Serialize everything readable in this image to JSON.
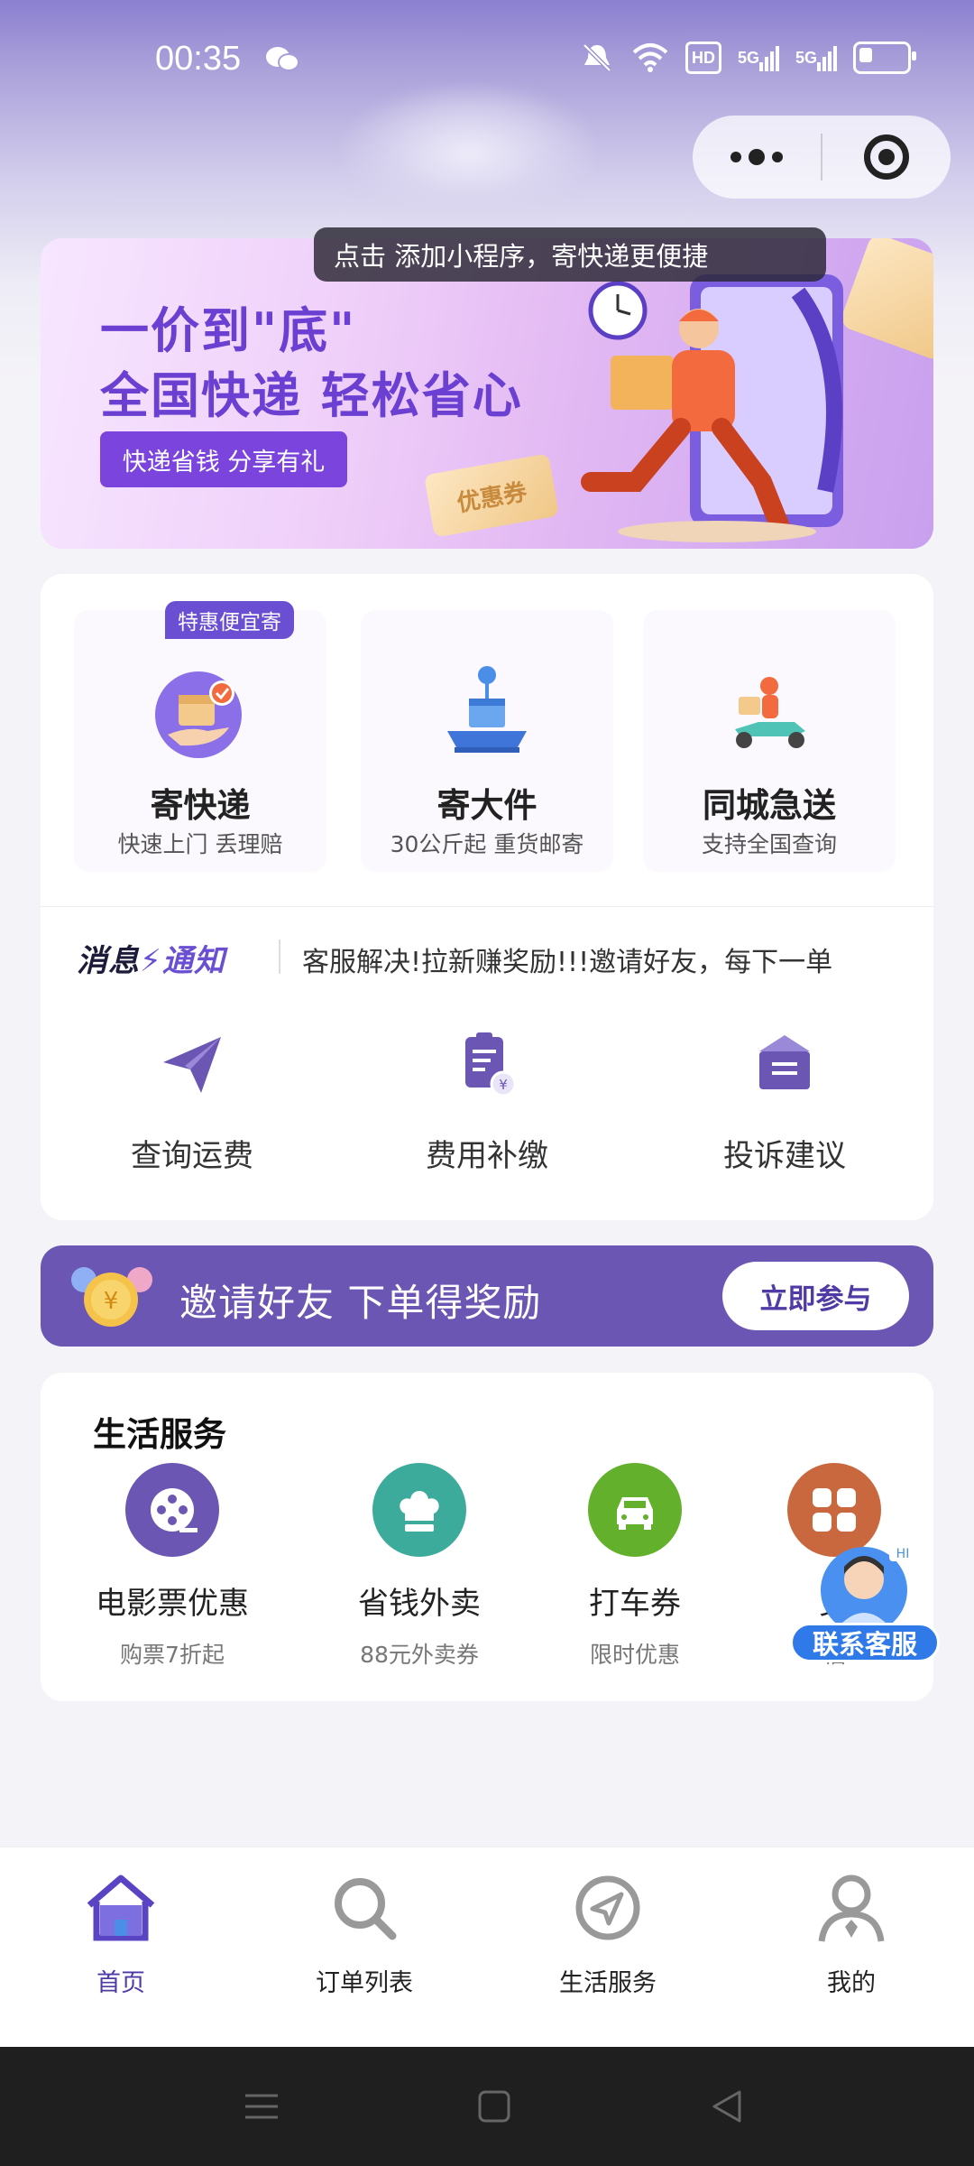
{
  "status_bar": {
    "time": "00:35",
    "hd_label": "HD",
    "net1": "5G",
    "net2": "5G"
  },
  "tooltip": {
    "text": "点击  添加小程序，寄快递更便捷"
  },
  "banner": {
    "title_line1": "一价到\"底\"",
    "title_line2": "全国快递 轻松省心",
    "button_label": "快递省钱 分享有礼",
    "coupon_label": "优惠券"
  },
  "services": {
    "badge": "特惠便宜寄",
    "items": [
      {
        "title": "寄快递",
        "subtitle": "快速上门 丢理赔"
      },
      {
        "title": "寄大件",
        "subtitle": "30公斤起 重货邮寄"
      },
      {
        "title": "同城急送",
        "subtitle": "支持全国查询"
      }
    ]
  },
  "notice": {
    "logo_part1": "消息",
    "logo_part2": "通知",
    "text": "客服解决!拉新赚奖励!!!邀请好友，每下一单"
  },
  "tools": [
    {
      "label": "查询运费"
    },
    {
      "label": "费用补缴"
    },
    {
      "label": "投诉建议"
    }
  ],
  "invite": {
    "text": "邀请好友 下单得奖励",
    "button_label": "立即参与"
  },
  "life": {
    "title": "生活服务",
    "items": [
      {
        "title": "电影票优惠",
        "subtitle": "购票7折起",
        "color": "#6b56b3"
      },
      {
        "title": "省钱外卖",
        "subtitle": "88元外卖券",
        "color": "#3dab9c"
      },
      {
        "title": "打车券",
        "subtitle": "限时优惠",
        "color": "#63b02c"
      },
      {
        "title": "更",
        "subtitle": "福",
        "color": "#c9683f"
      }
    ]
  },
  "customer_service": {
    "label": "联系客服",
    "hi": "HI"
  },
  "tabbar": {
    "items": [
      {
        "label": "首页",
        "active": true
      },
      {
        "label": "订单列表",
        "active": false
      },
      {
        "label": "生活服务",
        "active": false
      },
      {
        "label": "我的",
        "active": false
      }
    ],
    "accent": "#4f3aa6"
  }
}
